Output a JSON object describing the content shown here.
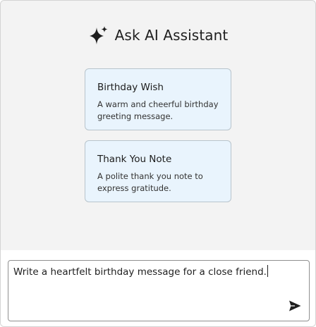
{
  "header": {
    "icon": "sparkle-icon",
    "title": "Ask AI Assistant"
  },
  "prompts": [
    {
      "title": "Birthday Wish",
      "description": "A warm and cheerful birthday greeting message."
    },
    {
      "title": "Thank You Note",
      "description": "A polite thank you note to express gratitude."
    }
  ],
  "composer": {
    "value": "Write a heartfelt birthday message for a close friend.",
    "send_icon": "send-icon"
  },
  "colors": {
    "card_background": "#e9f4fd",
    "card_border": "#b8c4cc",
    "panel_background": "#f3f3f3"
  }
}
